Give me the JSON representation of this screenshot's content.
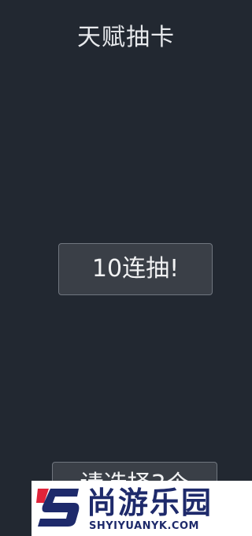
{
  "header": {
    "title": "天赋抽卡"
  },
  "actions": {
    "draw_ten_label": "10连抽!",
    "choose_label": "请选择3个"
  },
  "watermark": {
    "name": "尚游乐园",
    "url": "SHYIYUANYK.COM"
  },
  "colors": {
    "background": "#222831",
    "button": "#3a3f47",
    "watermark_navy": "#1e2a6b",
    "watermark_red": "#e0233a"
  }
}
